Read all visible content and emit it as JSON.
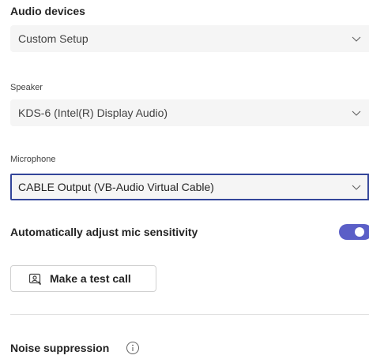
{
  "audio_devices": {
    "title": "Audio devices",
    "selected": "Custom Setup"
  },
  "speaker": {
    "label": "Speaker",
    "selected": "KDS-6 (Intel(R) Display Audio)"
  },
  "microphone": {
    "label": "Microphone",
    "selected": "CABLE Output (VB-Audio Virtual Cable)"
  },
  "mic_sensitivity": {
    "label": "Automatically adjust mic sensitivity",
    "enabled": true
  },
  "test_call": {
    "label": "Make a test call",
    "icon": "test-call-icon"
  },
  "noise_suppression": {
    "label": "Noise suppression",
    "icon": "info-icon"
  },
  "colors": {
    "accent": "#5b5fc7",
    "focus_border": "#33459a",
    "field_background": "#f5f5f5"
  }
}
